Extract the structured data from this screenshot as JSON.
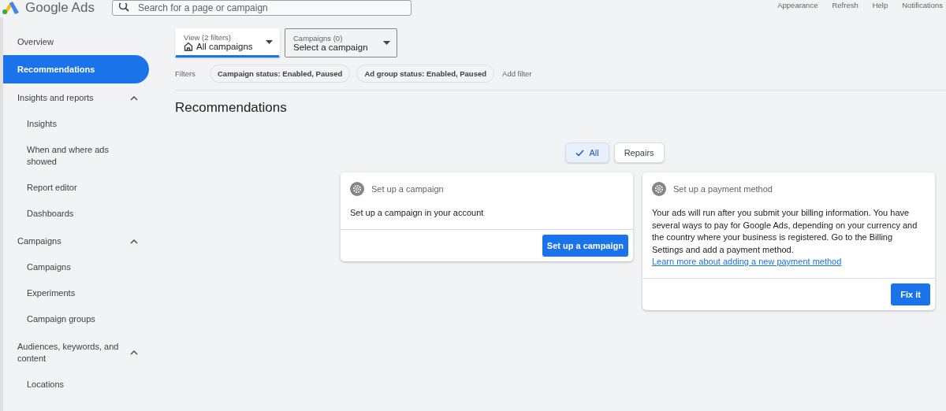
{
  "header": {
    "product_name": "Google Ads",
    "search": {
      "placeholder": "Search for a page or campaign"
    },
    "actions": [
      "Appearance",
      "Refresh",
      "Help",
      "Notifications"
    ]
  },
  "sidebar": {
    "items": [
      {
        "kind": "link",
        "label": "Overview",
        "selected": false
      },
      {
        "kind": "link",
        "label": "Recommendations",
        "selected": true
      },
      {
        "kind": "section",
        "label": "Insights and reports",
        "expanded": true,
        "children": [
          {
            "label": "Insights",
            "selected": false
          },
          {
            "label": "When and where ads showed",
            "selected": false
          },
          {
            "label": "Report editor",
            "selected": false
          },
          {
            "label": "Dashboards",
            "selected": false
          }
        ]
      },
      {
        "kind": "section",
        "label": "Campaigns",
        "expanded": true,
        "children": [
          {
            "label": "Campaigns",
            "selected": false
          },
          {
            "label": "Experiments",
            "selected": false
          },
          {
            "label": "Campaign groups",
            "selected": false
          }
        ]
      },
      {
        "kind": "section",
        "label": "Audiences, keywords, and content",
        "expanded": true,
        "children": [
          {
            "label": "Locations",
            "selected": false
          }
        ]
      }
    ]
  },
  "selectors": [
    {
      "label": "View (2 filters)",
      "value": "All campaigns",
      "selected": true
    },
    {
      "label": "Campaigns (0)",
      "value": "Select a campaign",
      "selected": false
    }
  ],
  "filters": {
    "label": "Filters",
    "chips": [
      "Campaign status: Enabled, Paused",
      "Ad group status: Enabled, Paused"
    ],
    "add_filter": "Add filter"
  },
  "page_title": "Recommendations",
  "tabs": [
    {
      "label": "All",
      "selected": true
    },
    {
      "label": "Repairs",
      "selected": false
    }
  ],
  "cards": [
    {
      "title": "Set up a campaign",
      "body": "Set up a campaign in your account",
      "button": "Set up a campaign"
    },
    {
      "title": "Set up a payment method",
      "body": "Your ads will run after you submit your billing information. You have several ways to pay for Google Ads, depending on your currency and the country where your business is registered. Go to the Billing Settings and add a payment method.",
      "link": "Learn more about adding a new payment method",
      "button": "Fix it"
    }
  ]
}
